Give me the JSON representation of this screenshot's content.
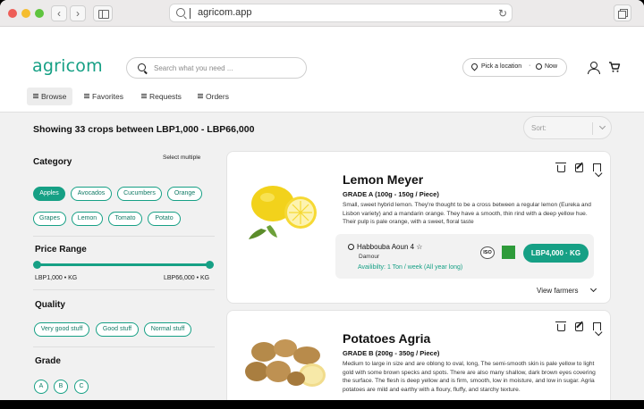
{
  "browser": {
    "url": "agricom.app"
  },
  "header": {
    "logo": "agricom",
    "search_placeholder": "Search what you need ...",
    "location_label": "Pick a location",
    "separator": "·",
    "time_label": "Now",
    "accent_color": "#16a085"
  },
  "nav": {
    "items": [
      {
        "label": "Browse",
        "active": true
      },
      {
        "label": "Favorites",
        "active": false
      },
      {
        "label": "Requests",
        "active": false
      },
      {
        "label": "Orders",
        "active": false
      }
    ]
  },
  "results": {
    "summary": "Showing 33 crops between LBP1,000 - LBP66,000",
    "sort_placeholder": "Sort:"
  },
  "filters": {
    "category": {
      "title": "Category",
      "hint": "Select multiple",
      "options": [
        {
          "label": "Apples",
          "selected": true
        },
        {
          "label": "Avocados",
          "selected": false
        },
        {
          "label": "Cucumbers",
          "selected": false
        },
        {
          "label": "Orange",
          "selected": false
        },
        {
          "label": "Grapes",
          "selected": false
        },
        {
          "label": "Lemon",
          "selected": false
        },
        {
          "label": "Tomato",
          "selected": false
        },
        {
          "label": "Potato",
          "selected": false
        }
      ]
    },
    "price_range": {
      "title": "Price Range",
      "min_label": "LBP1,000 • KG",
      "max_label": "LBP66,000 • KG",
      "min_fraction": 0.0,
      "max_fraction": 1.0
    },
    "quality": {
      "title": "Quality",
      "options": [
        "Very good stuff",
        "Good stuff",
        "Normal stuff"
      ]
    },
    "grade": {
      "title": "Grade",
      "options": [
        "A",
        "B",
        "C"
      ]
    }
  },
  "products": [
    {
      "title": "Lemon Meyer",
      "grade": "GRADE A (100g - 150g / Piece)",
      "description": "Small, sweet hybrid lemon. They're thought to be a cross between a regular lemon (Eureka and Lisbon variety) and a mandarin orange. They have a smooth, thin rind with a deep yellow hue. Their pulp is pale orange, with a sweet, floral taste",
      "seller": "Habbouba Aoun 4 ☆",
      "town": "Damour",
      "availability": "Availibilty: 1 Ton / week (All year long)",
      "badge_iso": "ISO",
      "price": "LBP4,000 · KG",
      "view_farmers": "View farmers"
    },
    {
      "title": "Potatoes Agria",
      "grade": "GRADE B (200g - 350g / Piece)",
      "description": "Medium to large in size and are oblong to oval, long, The semi-smooth skin is pale yellow to light gold with some brown specks and spots. There are also many shallow, dark brown eyes covering the surface. The flesh is deep yellow and is firm, smooth, low in moisture, and low in sugar. Agria potatoes are mild and earthy with a floury, fluffy, and starchy texture."
    }
  ]
}
